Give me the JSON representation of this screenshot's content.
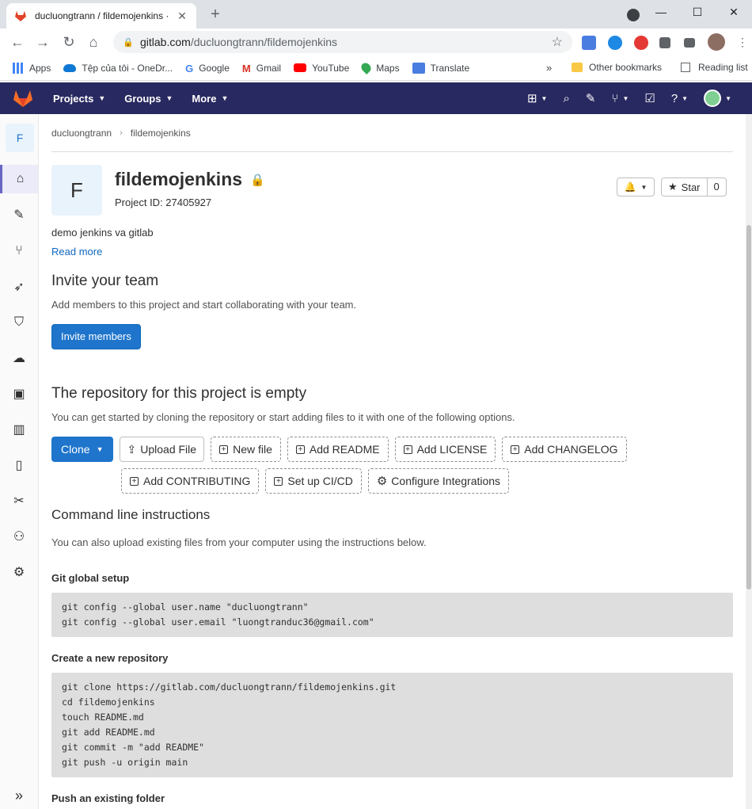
{
  "browser": {
    "tab_title": "ducluongtrann / fildemojenkins ·",
    "url_host": "gitlab.com",
    "url_path": "/ducluongtrann/fildemojenkins",
    "bookmarks": [
      {
        "label": "Apps",
        "icon": "apps-grid-icon"
      },
      {
        "label": "Tệp của tôi - OneDr...",
        "icon": "onedrive-icon"
      },
      {
        "label": "Google",
        "icon": "google-icon"
      },
      {
        "label": "Gmail",
        "icon": "gmail-icon"
      },
      {
        "label": "YouTube",
        "icon": "youtube-icon"
      },
      {
        "label": "Maps",
        "icon": "maps-icon"
      },
      {
        "label": "Translate",
        "icon": "translate-icon"
      }
    ],
    "other_bookmarks": "Other bookmarks",
    "reading_list": "Reading list"
  },
  "gitlab_nav": {
    "menus": [
      "Projects",
      "Groups",
      "More"
    ]
  },
  "sidebar": {
    "project_letter": "F",
    "items": [
      "home-icon",
      "issues-icon",
      "merge-requests-icon",
      "deployments-icon",
      "security-icon",
      "infrastructure-icon",
      "packages-icon",
      "analytics-icon",
      "wiki-icon",
      "snippets-icon",
      "members-icon",
      "settings-icon"
    ]
  },
  "breadcrumb": {
    "user": "ducluongtrann",
    "project": "fildemojenkins"
  },
  "project": {
    "avatar_letter": "F",
    "name": "fildemojenkins",
    "id_text": "Project ID: 27405927",
    "star_label": "Star",
    "star_count": "0",
    "description": "demo jenkins va gitlab",
    "read_more": "Read more"
  },
  "invite": {
    "title": "Invite your team",
    "subtitle": "Add members to this project and start collaborating with your team.",
    "button": "Invite members"
  },
  "empty_repo": {
    "title": "The repository for this project is empty",
    "subtitle": "You can get started by cloning the repository or start adding files to it with one of the following options.",
    "clone": "Clone",
    "upload": "Upload File",
    "new_file": "New file",
    "add_readme": "Add README",
    "add_license": "Add LICENSE",
    "add_changelog": "Add CHANGELOG",
    "add_contributing": "Add CONTRIBUTING",
    "setup_cicd": "Set up CI/CD",
    "configure": "Configure Integrations"
  },
  "cli": {
    "title": "Command line instructions",
    "subtitle": "You can also upload existing files from your computer using the instructions below.",
    "global_setup_title": "Git global setup",
    "global_setup_code": "git config --global user.name \"ducluongtrann\"\ngit config --global user.email \"luongtranduc36@gmail.com\"",
    "new_repo_title": "Create a new repository",
    "new_repo_code": "git clone https://gitlab.com/ducluongtrann/fildemojenkins.git\ncd fildemojenkins\ntouch README.md\ngit add README.md\ngit commit -m \"add README\"\ngit push -u origin main",
    "push_existing_title": "Push an existing folder"
  },
  "colors": {
    "nav_bg": "#292961",
    "primary": "#1f75cb",
    "link": "#1068bf",
    "code_bg": "#dedede"
  }
}
